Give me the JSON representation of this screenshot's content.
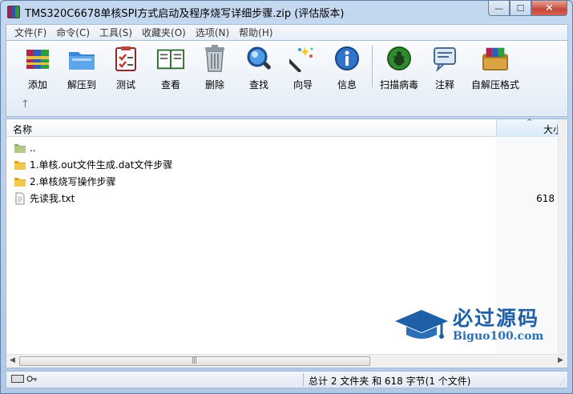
{
  "window": {
    "title": "TMS320C6678单核SPI方式启动及程序烧写详细步骤.zip (评估版本)",
    "caption": {
      "minimize": "—",
      "maximize": "☐",
      "close": "✕"
    }
  },
  "menu": [
    "文件(F)",
    "命令(C)",
    "工具(S)",
    "收藏夹(O)",
    "选项(N)",
    "帮助(H)"
  ],
  "toolbar": {
    "buttons": [
      {
        "label": "添加",
        "icon": "add-archive-icon"
      },
      {
        "label": "解压到",
        "icon": "extract-to-icon"
      },
      {
        "label": "测试",
        "icon": "test-icon"
      },
      {
        "label": "查看",
        "icon": "view-icon"
      },
      {
        "label": "删除",
        "icon": "delete-icon"
      },
      {
        "label": "查找",
        "icon": "find-icon"
      },
      {
        "label": "向导",
        "icon": "wizard-icon"
      },
      {
        "label": "信息",
        "icon": "info-icon"
      },
      {
        "label": "扫描病毒",
        "icon": "virus-scan-icon"
      },
      {
        "label": "注释",
        "icon": "comment-icon"
      },
      {
        "label": "自解压格式",
        "icon": "sfx-icon"
      }
    ],
    "up_arrow": "↑"
  },
  "list": {
    "columns": {
      "name": "名称",
      "size": "大小"
    },
    "rows": [
      {
        "name": "..",
        "size": "",
        "type": "parent-folder"
      },
      {
        "name": "1.单核.out文件生成.dat文件步骤",
        "size": "",
        "type": "folder"
      },
      {
        "name": "2.单核烧写操作步骤",
        "size": "",
        "type": "folder"
      },
      {
        "name": "先读我.txt",
        "size": "618",
        "type": "text-file"
      }
    ]
  },
  "status": {
    "text": "总计 2 文件夹 和 618 字节(1 个文件)"
  },
  "watermark": {
    "title": "必过源码",
    "url": "Biguo100.com"
  }
}
